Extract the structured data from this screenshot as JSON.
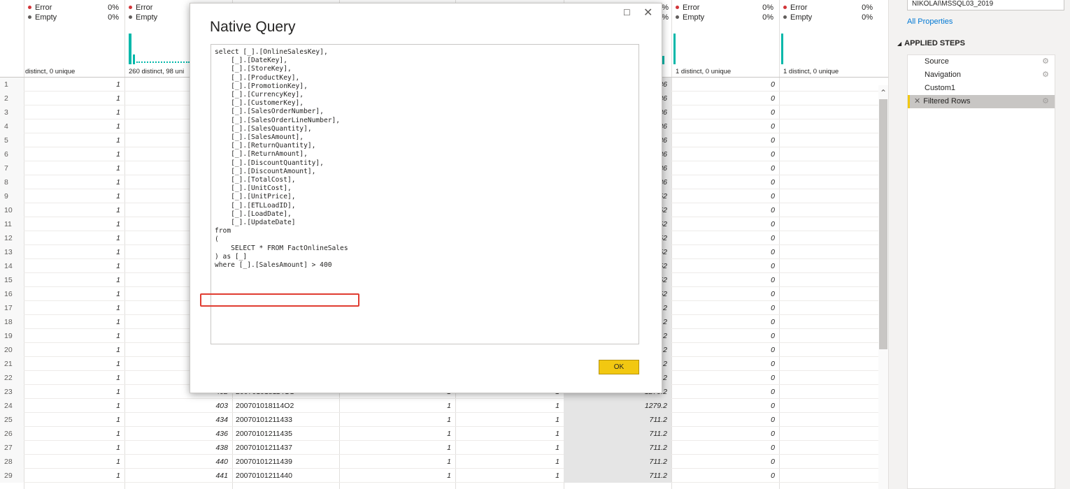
{
  "profile": [
    {
      "error_label": "Error",
      "error_pct": "0%",
      "empty_label": "Empty",
      "empty_pct": "0%",
      "distinct": "distinct, 0 unique"
    },
    {
      "error_label": "Error",
      "error_pct": "",
      "empty_label": "Empty",
      "empty_pct": "",
      "distinct": "260 distinct, 98 uni"
    },
    {
      "error_label": "",
      "error_pct": "%",
      "empty_label": "",
      "empty_pct": "%",
      "distinct": ""
    },
    {
      "error_label": "Error",
      "error_pct": "0%",
      "empty_label": "Empty",
      "empty_pct": "0%",
      "distinct": "1 distinct, 0 unique"
    },
    {
      "error_label": "Error",
      "error_pct": "0%",
      "empty_label": "Empty",
      "empty_pct": "0%",
      "distinct": "1 distinct, 0 unique"
    }
  ],
  "rows": [
    {
      "n": "1",
      "a": "1",
      "b": "",
      "c": "",
      "d": "",
      "e": "",
      "f": "36",
      "g": "0"
    },
    {
      "n": "2",
      "a": "1",
      "b": "",
      "c": "",
      "d": "",
      "e": "",
      "f": "36",
      "g": "0"
    },
    {
      "n": "3",
      "a": "1",
      "b": "",
      "c": "",
      "d": "",
      "e": "",
      "f": "36",
      "g": "0"
    },
    {
      "n": "4",
      "a": "1",
      "b": "",
      "c": "",
      "d": "",
      "e": "",
      "f": "36",
      "g": "0"
    },
    {
      "n": "5",
      "a": "1",
      "b": "",
      "c": "",
      "d": "",
      "e": "",
      "f": "36",
      "g": "0"
    },
    {
      "n": "6",
      "a": "1",
      "b": "",
      "c": "",
      "d": "",
      "e": "",
      "f": "36",
      "g": "0"
    },
    {
      "n": "7",
      "a": "1",
      "b": "",
      "c": "",
      "d": "",
      "e": "",
      "f": "36",
      "g": "0"
    },
    {
      "n": "8",
      "a": "1",
      "b": "",
      "c": "",
      "d": "",
      "e": "",
      "f": "36",
      "g": "0"
    },
    {
      "n": "9",
      "a": "1",
      "b": "",
      "c": "",
      "d": "",
      "e": "",
      "f": "52",
      "g": "0"
    },
    {
      "n": "10",
      "a": "1",
      "b": "",
      "c": "",
      "d": "",
      "e": "",
      "f": "52",
      "g": "0"
    },
    {
      "n": "11",
      "a": "1",
      "b": "",
      "c": "",
      "d": "",
      "e": "",
      "f": "52",
      "g": "0"
    },
    {
      "n": "12",
      "a": "1",
      "b": "",
      "c": "",
      "d": "",
      "e": "",
      "f": "52",
      "g": "0"
    },
    {
      "n": "13",
      "a": "1",
      "b": "",
      "c": "",
      "d": "",
      "e": "",
      "f": "52",
      "g": "0"
    },
    {
      "n": "14",
      "a": "1",
      "b": "",
      "c": "",
      "d": "",
      "e": "",
      "f": "52",
      "g": "0"
    },
    {
      "n": "15",
      "a": "1",
      "b": "",
      "c": "",
      "d": "",
      "e": "",
      "f": "52",
      "g": "0"
    },
    {
      "n": "16",
      "a": "1",
      "b": "",
      "c": "",
      "d": "",
      "e": "",
      "f": "52",
      "g": "0"
    },
    {
      "n": "17",
      "a": "1",
      "b": "",
      "c": "",
      "d": "",
      "e": "",
      "f": ".2",
      "g": "0"
    },
    {
      "n": "18",
      "a": "1",
      "b": "",
      "c": "",
      "d": "",
      "e": "",
      "f": ".2",
      "g": "0"
    },
    {
      "n": "19",
      "a": "1",
      "b": "",
      "c": "",
      "d": "",
      "e": "",
      "f": ".2",
      "g": "0"
    },
    {
      "n": "20",
      "a": "1",
      "b": "",
      "c": "",
      "d": "",
      "e": "",
      "f": ".2",
      "g": "0"
    },
    {
      "n": "21",
      "a": "1",
      "b": "",
      "c": "",
      "d": "",
      "e": "",
      "f": ".2",
      "g": "0"
    },
    {
      "n": "22",
      "a": "1",
      "b": "",
      "c": "",
      "d": "",
      "e": "",
      "f": ".2",
      "g": "0"
    },
    {
      "n": "23",
      "a": "1",
      "b": "402",
      "c": "200701018114O1",
      "d": "1",
      "e": "1",
      "f": "1279.2",
      "g": "0"
    },
    {
      "n": "24",
      "a": "1",
      "b": "403",
      "c": "200701018114O2",
      "d": "1",
      "e": "1",
      "f": "1279.2",
      "g": "0"
    },
    {
      "n": "25",
      "a": "1",
      "b": "434",
      "c": "20070101211433",
      "d": "1",
      "e": "1",
      "f": "711.2",
      "g": "0"
    },
    {
      "n": "26",
      "a": "1",
      "b": "436",
      "c": "20070101211435",
      "d": "1",
      "e": "1",
      "f": "711.2",
      "g": "0"
    },
    {
      "n": "27",
      "a": "1",
      "b": "438",
      "c": "20070101211437",
      "d": "1",
      "e": "1",
      "f": "711.2",
      "g": "0"
    },
    {
      "n": "28",
      "a": "1",
      "b": "440",
      "c": "20070101211439",
      "d": "1",
      "e": "1",
      "f": "711.2",
      "g": "0"
    },
    {
      "n": "29",
      "a": "1",
      "b": "441",
      "c": "20070101211440",
      "d": "1",
      "e": "1",
      "f": "711.2",
      "g": "0"
    }
  ],
  "pane": {
    "name_value": "NIKOLAI\\MSSQL03_2019",
    "all_properties": "All Properties",
    "steps_title": "APPLIED STEPS",
    "steps": [
      {
        "label": "Source",
        "has_gear": true
      },
      {
        "label": "Navigation",
        "has_gear": true
      },
      {
        "label": "Custom1",
        "has_gear": false
      },
      {
        "label": "Filtered Rows",
        "has_gear": true
      }
    ]
  },
  "dialog": {
    "title": "Native Query",
    "ok_label": "OK",
    "query": "select [_].[OnlineSalesKey],\n    [_].[DateKey],\n    [_].[StoreKey],\n    [_].[ProductKey],\n    [_].[PromotionKey],\n    [_].[CurrencyKey],\n    [_].[CustomerKey],\n    [_].[SalesOrderNumber],\n    [_].[SalesOrderLineNumber],\n    [_].[SalesQuantity],\n    [_].[SalesAmount],\n    [_].[ReturnQuantity],\n    [_].[ReturnAmount],\n    [_].[DiscountQuantity],\n    [_].[DiscountAmount],\n    [_].[TotalCost],\n    [_].[UnitCost],\n    [_].[UnitPrice],\n    [_].[ETLLoadID],\n    [_].[LoadDate],\n    [_].[UpdateDate]\nfrom\n(\n    SELECT * FROM FactOnlineSales\n) as [_]\nwhere [_].[SalesAmount] > 400"
  },
  "colors": {
    "accent_yellow": "#f2c811",
    "histogram": "#01b8aa",
    "error_dot": "#d13438",
    "highlight_box": "#e03c31",
    "link": "#0078d4"
  }
}
